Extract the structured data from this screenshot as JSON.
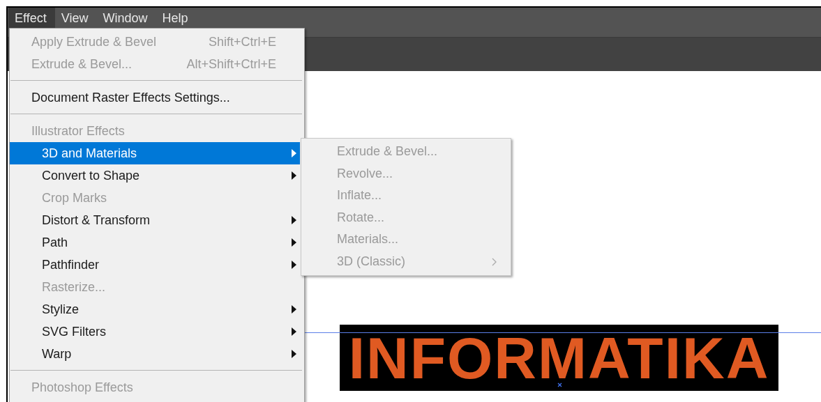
{
  "menu_bar": [
    {
      "label": "Effect",
      "selected": true
    },
    {
      "label": "View",
      "selected": false
    },
    {
      "label": "Window",
      "selected": false
    },
    {
      "label": "Help",
      "selected": false
    }
  ],
  "effect_menu": [
    {
      "kind": "command",
      "label": "Apply Extrude & Bevel",
      "shortcut": "Shift+Ctrl+E",
      "disabled": true
    },
    {
      "kind": "command",
      "label": "Extrude & Bevel...",
      "shortcut": "Alt+Shift+Ctrl+E",
      "disabled": true
    },
    {
      "kind": "separator"
    },
    {
      "kind": "command",
      "label": "Document Raster Effects Settings...",
      "disabled": false
    },
    {
      "kind": "separator"
    },
    {
      "kind": "header",
      "label": "Illustrator Effects",
      "children": [
        {
          "label": "3D and Materials",
          "submenu": true,
          "disabled": false,
          "selected": true
        },
        {
          "label": "Convert to Shape",
          "submenu": true,
          "disabled": false,
          "selected": false
        },
        {
          "label": "Crop Marks",
          "submenu": false,
          "disabled": true,
          "selected": false
        },
        {
          "label": "Distort & Transform",
          "submenu": true,
          "disabled": false,
          "selected": false
        },
        {
          "label": "Path",
          "submenu": true,
          "disabled": false,
          "selected": false
        },
        {
          "label": "Pathfinder",
          "submenu": true,
          "disabled": false,
          "selected": false
        },
        {
          "label": "Rasterize...",
          "submenu": false,
          "disabled": true,
          "selected": false
        },
        {
          "label": "Stylize",
          "submenu": true,
          "disabled": false,
          "selected": false
        },
        {
          "label": "SVG Filters",
          "submenu": true,
          "disabled": false,
          "selected": false
        },
        {
          "label": "Warp",
          "submenu": true,
          "disabled": false,
          "selected": false
        }
      ]
    },
    {
      "kind": "separator"
    },
    {
      "kind": "header",
      "label": "Photoshop Effects"
    }
  ],
  "submenu": [
    {
      "label": "Extrude & Bevel...",
      "disabled": true,
      "submenu": false
    },
    {
      "label": "Revolve...",
      "disabled": true,
      "submenu": false
    },
    {
      "label": "Inflate...",
      "disabled": true,
      "submenu": false
    },
    {
      "label": "Rotate...",
      "disabled": true,
      "submenu": false
    },
    {
      "label": "Materials...",
      "disabled": true,
      "submenu": false
    },
    {
      "label": "3D (Classic)",
      "disabled": true,
      "submenu": true
    }
  ],
  "canvas": {
    "artwork_text": "INFORMATIKA"
  }
}
